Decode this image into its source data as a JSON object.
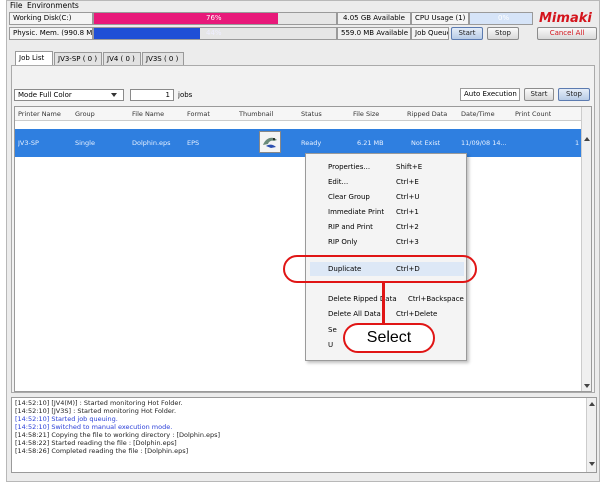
{
  "menu": {
    "file": "File",
    "environments": "Environments"
  },
  "status": {
    "working_disk_label": "Working Disk(C:)",
    "working_disk_percent": "76%",
    "working_disk_fraction": 0.76,
    "working_disk_available": "4.05 GB Available",
    "cpu_usage_label": "CPU Usage (1)",
    "cpu_usage_percent": "0%",
    "physical_memory_label": "Physic. Mem. (990.8 MB)",
    "physical_memory_percent": "44%",
    "physical_memory_fraction": 0.44,
    "physical_memory_available": "559.0 MB Available",
    "job_queue_label": "Job Queue",
    "start_label": "Start",
    "stop_label": "Stop",
    "cancel_all_label": "Cancel All",
    "brand_logo": "Mimaki",
    "accent_pink": "#e8197a",
    "accent_blue": "#1f4fd6",
    "brand_red": "#d4141c"
  },
  "tabs": [
    "Job List",
    "JV3-SP ( 0 )",
    "JV4 ( 0 )",
    "JV3S ( 0 )"
  ],
  "toolbar": {
    "mode_value": "Mode Full Color",
    "jobs_count": "1",
    "jobs_label": "jobs",
    "auto_execution_label": "Auto Execution",
    "start_label": "Start",
    "stop_label": "Stop"
  },
  "table": {
    "headers": [
      "Printer Name",
      "Group",
      "File Name",
      "Format",
      "Thumbnail",
      "Status",
      "File Size",
      "Ripped Data",
      "Date/Time",
      "Print Count"
    ],
    "rows": [
      {
        "printer": "JV3-SP",
        "group": "Single",
        "file": "Dolphin.eps",
        "format": "EPS",
        "status": "Ready",
        "size": "6.21 MB",
        "ripped": "Not Exist",
        "datetime": "11/09/08 14...",
        "count": "1"
      }
    ],
    "row_color": "#2f7fe0"
  },
  "context_menu": {
    "items": [
      {
        "label": "Properties...",
        "shortcut": "Shift+E"
      },
      {
        "label": "Edit...",
        "shortcut": "Ctrl+E"
      },
      {
        "label": "Clear Group",
        "shortcut": "Ctrl+U"
      },
      {
        "label": "Immediate Print",
        "shortcut": "Ctrl+1"
      },
      {
        "label": "RIP and Print",
        "shortcut": "Ctrl+2"
      },
      {
        "label": "RIP Only",
        "shortcut": "Ctrl+3"
      },
      {
        "label": "Duplicate",
        "shortcut": "Ctrl+D"
      },
      {
        "label": "Delete Ripped Data",
        "shortcut": "Ctrl+Backspace"
      },
      {
        "label": "Delete All Data",
        "shortcut": "Ctrl+Delete"
      },
      {
        "label": "Se",
        "shortcut": ""
      },
      {
        "label": "U",
        "shortcut": ""
      }
    ]
  },
  "callout": {
    "label": "Select",
    "color": "#e01515"
  },
  "log": {
    "lines": [
      {
        "text": "[14:52:10] [JV4(M)] : Started monitoring Hot Folder.",
        "color": "#222222"
      },
      {
        "text": "[14:52:10] [JV3S] : Started monitoring Hot Folder.",
        "color": "#222222"
      },
      {
        "text": "[14:52:10] Started job queuing.",
        "color": "#2a3fd8"
      },
      {
        "text": "[14:52:10] Switched to manual execution mode.",
        "color": "#2a3fd8"
      },
      {
        "text": "[14:58:21] Copying the file to working directory : [Dolphin.eps]",
        "color": "#222222"
      },
      {
        "text": "[14:58:22] Started reading the file : [Dolphin.eps]",
        "color": "#222222"
      },
      {
        "text": "[14:58:26] Completed reading the file : [Dolphin.eps]",
        "color": "#222222"
      }
    ]
  }
}
